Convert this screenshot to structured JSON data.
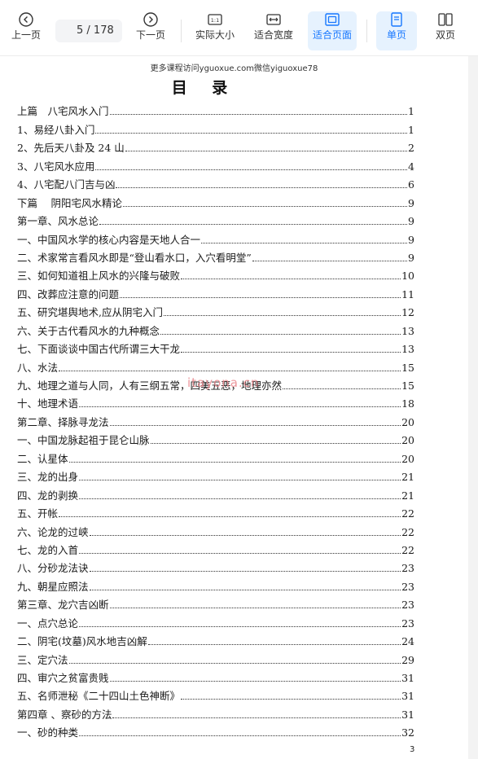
{
  "toolbar": {
    "prev_label": "上一页",
    "current_page": "5",
    "total_pages": "/ 178",
    "next_label": "下一页",
    "actual_size_label": "实际大小",
    "actual_size_icon_text": "1:1",
    "fit_width_label": "适合宽度",
    "fit_page_label": "适合页面",
    "single_label": "单页",
    "double_label": "双页",
    "accent_color": "#1677ff"
  },
  "document": {
    "top_watermark": "更多课程访问yguoxue.com微信yiguoxue78",
    "title": "目 录",
    "center_watermark": "itayona.cn",
    "page_number": "3",
    "toc": [
      {
        "title": "上篇　八宅风水入门",
        "page": "1"
      },
      {
        "title": "1、易经八卦入门",
        "page": "1"
      },
      {
        "title": "2、先后天八卦及 24 山",
        "page": "2"
      },
      {
        "title": "3、八宅风水应用",
        "page": "4"
      },
      {
        "title": "4、八宅配八门吉与凶",
        "page": "6"
      },
      {
        "title": "下篇　 阴阳宅风水精论",
        "page": "9"
      },
      {
        "title": "第一章、风水总论",
        "page": "9"
      },
      {
        "title": "一、中国风水学的核心内容是天地人合一",
        "page": "9"
      },
      {
        "title": "二、术家常言看风水即是“登山看水口，入穴看明堂”",
        "page": "9"
      },
      {
        "title": "三、如何知道祖上风水的兴隆与破败",
        "page": "10"
      },
      {
        "title": "四、改葬应注意的问题",
        "page": "11"
      },
      {
        "title": "五、研究堪舆地术,应从阴宅入门",
        "page": "12"
      },
      {
        "title": "六、关于古代看风水的九种概念",
        "page": "13"
      },
      {
        "title": "七、下面谈谈中国古代所谓三大干龙",
        "page": "13"
      },
      {
        "title": "八、水法",
        "page": "15"
      },
      {
        "title": "九、地理之道与人同，人有三纲五常，四美五恶，地理亦然",
        "page": "15"
      },
      {
        "title": "十、地理术语",
        "page": "18"
      },
      {
        "title": "第二章、择脉寻龙法",
        "page": "20"
      },
      {
        "title": "一、中国龙脉起祖于昆仑山脉",
        "page": "20"
      },
      {
        "title": "二、认星体",
        "page": "20"
      },
      {
        "title": "三、龙的出身",
        "page": "21"
      },
      {
        "title": "四、龙的剥换",
        "page": "21"
      },
      {
        "title": "五、开帐",
        "page": "22"
      },
      {
        "title": "六、论龙的过峡",
        "page": "22"
      },
      {
        "title": "七、龙的入首",
        "page": "22"
      },
      {
        "title": "八、分砂龙法诀",
        "page": "23"
      },
      {
        "title": "九、朝星应照法",
        "page": "23"
      },
      {
        "title": "第三章、龙穴吉凶断",
        "page": "23"
      },
      {
        "title": "一、点穴总论",
        "page": "23"
      },
      {
        "title": "二、阴宅(坟墓)风水地吉凶解",
        "page": "24"
      },
      {
        "title": "三、定穴法",
        "page": "29"
      },
      {
        "title": "四、审穴之贫富贵贱",
        "page": "31"
      },
      {
        "title": "五、名师泄秘《二十四山土色神断》",
        "page": "31"
      },
      {
        "title": "第四章 、察砂的方法",
        "page": "31"
      },
      {
        "title": "一、砂的种类",
        "page": "32"
      }
    ]
  }
}
